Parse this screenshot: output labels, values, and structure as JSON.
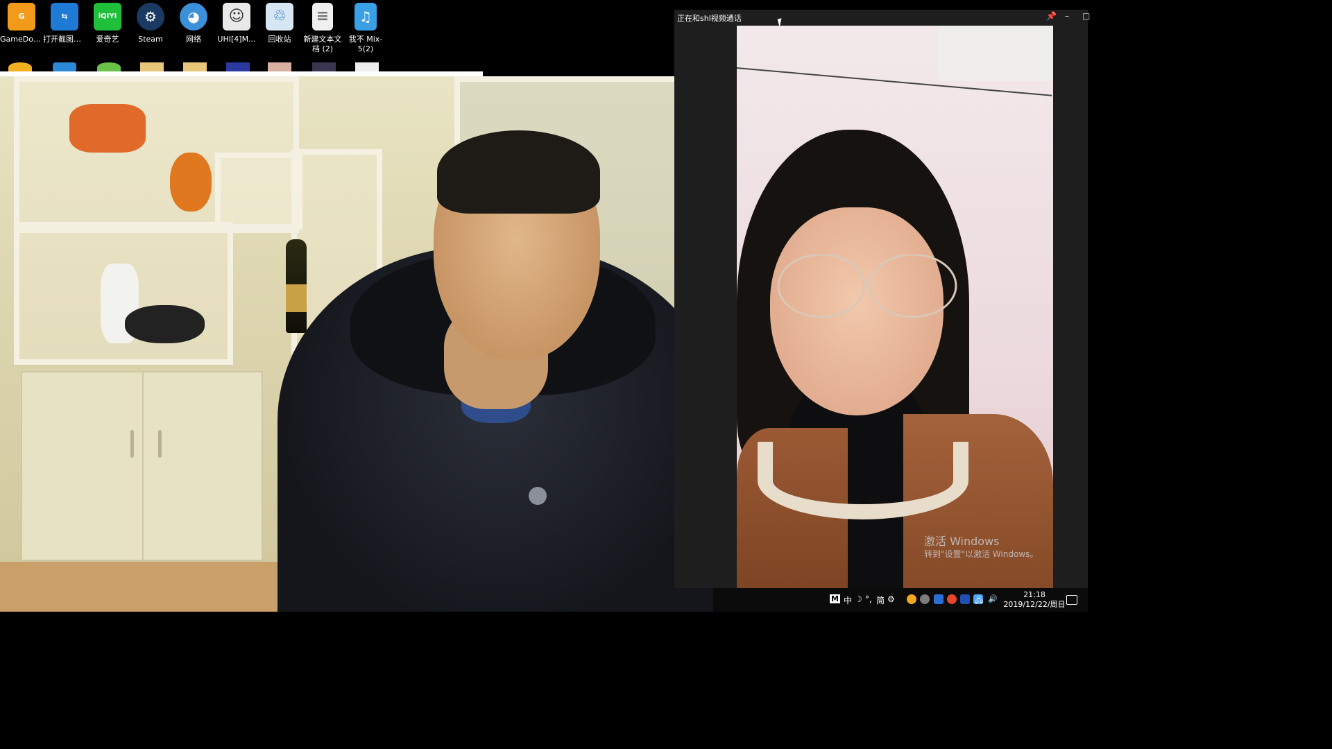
{
  "desktop": {
    "icons": [
      {
        "label": "GameDow...",
        "icon": "gamedow-icon",
        "color": "#f29a1a",
        "glyph": "G"
      },
      {
        "label": "打开截图给我",
        "icon": "teamviewer-icon",
        "color": "#1f7ad6",
        "glyph": "⇆"
      },
      {
        "label": "爱奇艺",
        "icon": "iqiyi-icon",
        "color": "#1fbf3a",
        "glyph": "iQIYI"
      },
      {
        "label": "Steam",
        "icon": "steam-icon",
        "color": "#1b3a63",
        "glyph": "⚙"
      },
      {
        "label": "网络",
        "icon": "network-icon",
        "color": "#3c8fd9",
        "glyph": "◕"
      },
      {
        "label": "UHI[4]M...",
        "icon": "uhi-icon",
        "color": "#e9e9e9",
        "glyph": "☺"
      },
      {
        "label": "回收站",
        "icon": "recycle-bin-icon",
        "color": "#d6e6f2",
        "glyph": "♲"
      },
      {
        "label": "新建文本文档 (2)",
        "icon": "text-file-icon",
        "color": "#f0f0f0",
        "glyph": "≡"
      },
      {
        "label": "我不 Mix-5(2)",
        "icon": "mp3-icon",
        "color": "#3aa0e6",
        "glyph": "♫"
      }
    ]
  },
  "call_window": {
    "title": "正在和shl视频通话",
    "pin": "📌",
    "minimize": "–",
    "maximize": "□"
  },
  "watermark": {
    "line1": "激活 Windows",
    "line2": "转到\"设置\"以激活 Windows。"
  },
  "taskbar": {
    "ime_mode": "M",
    "ime_lang": "中",
    "ime_moon": "☽",
    "ime_punct": "°,",
    "ime_simplified": "简",
    "ime_settings": "⚙",
    "volume": "🔊",
    "network": "🖧",
    "time": "21:18",
    "date": "2019/12/22/周日"
  }
}
